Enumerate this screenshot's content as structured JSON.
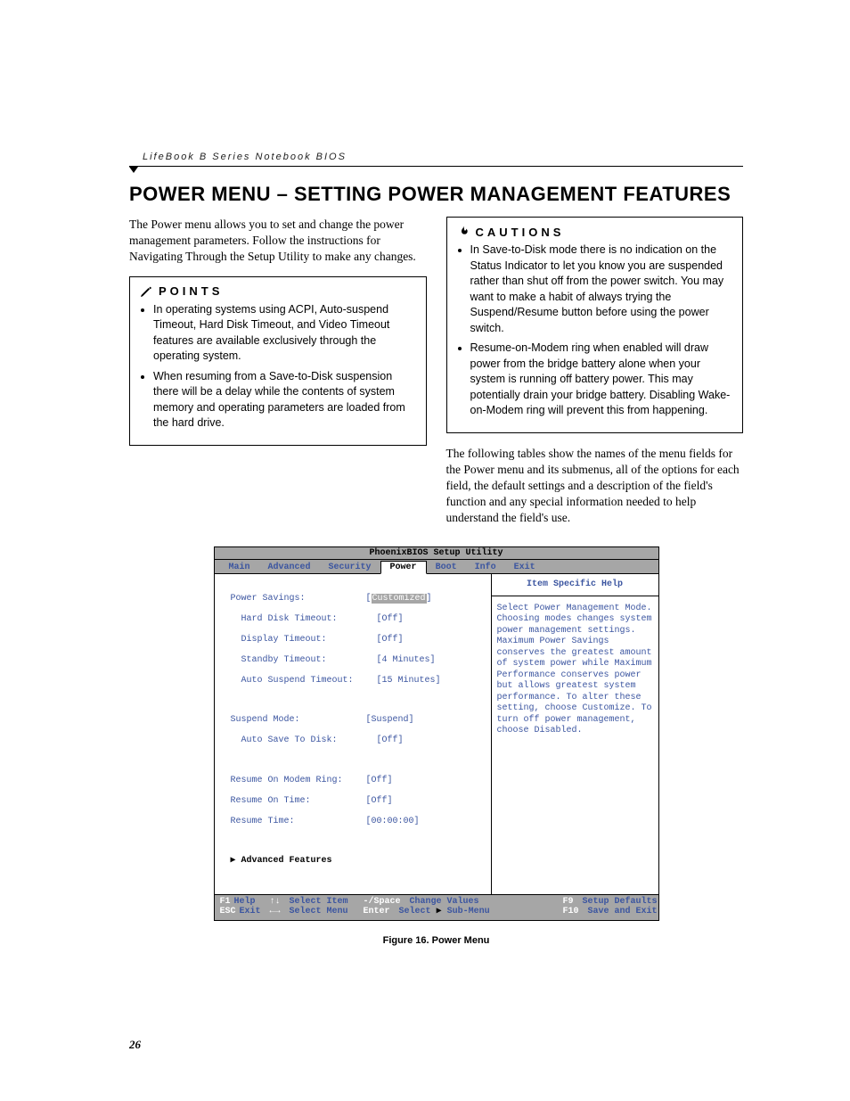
{
  "header_label": "LifeBook B Series Notebook BIOS",
  "title": "POWER MENU – SETTING POWER MANAGEMENT FEATURES",
  "intro": "The Power menu allows you to set and change the power management parameters. Follow the instructions for Navigating Through the Setup Utility to make any changes.",
  "points": {
    "label": "POINTS",
    "items": [
      "In operating systems using ACPI, Auto-suspend Timeout, Hard Disk Timeout, and Video Timeout features are available exclusively through the operating system.",
      "When resuming from a Save-to-Disk suspension there will be a delay while the contents of system memory and operating parameters are loaded from the hard drive."
    ]
  },
  "cautions": {
    "label": "CAUTIONS",
    "items": [
      "In Save-to-Disk mode there is no indication on the Status Indicator to let you know you are suspended rather than shut off from the power switch. You may want to make a habit of always trying the Suspend/Resume button before using the power switch.",
      "Resume-on-Modem ring when enabled will draw power from the bridge battery alone when your system is running off battery power. This may potentially drain your bridge battery. Disabling Wake-on-Modem ring will prevent this from happening."
    ]
  },
  "right_intro": "The following tables show the names of the menu fields for the Power menu and its submenus, all of the options for each field, the default settings and a description of the field's function and any special information needed to help understand the field's use.",
  "bios": {
    "title": "PhoenixBIOS Setup Utility",
    "tabs": [
      "Main",
      "Advanced",
      "Security",
      "Power",
      "Boot",
      "Info",
      "Exit"
    ],
    "active_tab": "Power",
    "fields": {
      "power_savings": {
        "label": "Power Savings:",
        "value": "Customized",
        "selected": true
      },
      "hard_disk": {
        "label": "Hard Disk Timeout:",
        "value": "[Off]"
      },
      "display": {
        "label": "Display Timeout:",
        "value": "[Off]"
      },
      "standby": {
        "label": "Standby Timeout:",
        "value": "[4 Minutes]"
      },
      "auto_suspend": {
        "label": "Auto Suspend Timeout:",
        "value": "[15 Minutes]"
      },
      "suspend_mode": {
        "label": "Suspend Mode:",
        "value": "[Suspend]"
      },
      "auto_save": {
        "label": "Auto Save To Disk:",
        "value": "[Off]"
      },
      "resume_modem": {
        "label": "Resume On Modem Ring:",
        "value": "[Off]"
      },
      "resume_time": {
        "label": "Resume On Time:",
        "value": "[Off]"
      },
      "resume_at": {
        "label": "Resume Time:",
        "value": "[00:00:00]"
      },
      "advanced": {
        "label": "Advanced Features"
      }
    },
    "help": {
      "title": "Item Specific Help",
      "body": "Select Power Management Mode. Choosing modes changes system power management settings. Maximum Power Savings conserves the greatest amount of system power while Maximum Performance conserves power but allows greatest system performance. To alter these setting, choose Customize. To turn off power management, choose Disabled."
    },
    "footer": {
      "f1": "F1",
      "help": "Help",
      "esc": "ESC",
      "exit": "Exit",
      "sel_item_k": "↑↓",
      "sel_item": "Select Item",
      "sel_menu_k": "←→",
      "sel_menu": "Select Menu",
      "change_k": "-/Space",
      "change": "Change Values",
      "enter_k": "Enter",
      "enter": "Select",
      "submenu": "Sub-Menu",
      "f9": "F9",
      "defaults": "Setup Defaults",
      "f10": "F10",
      "save": "Save and Exit"
    }
  },
  "figure_caption": "Figure 16.  Power Menu",
  "page_number": "26"
}
